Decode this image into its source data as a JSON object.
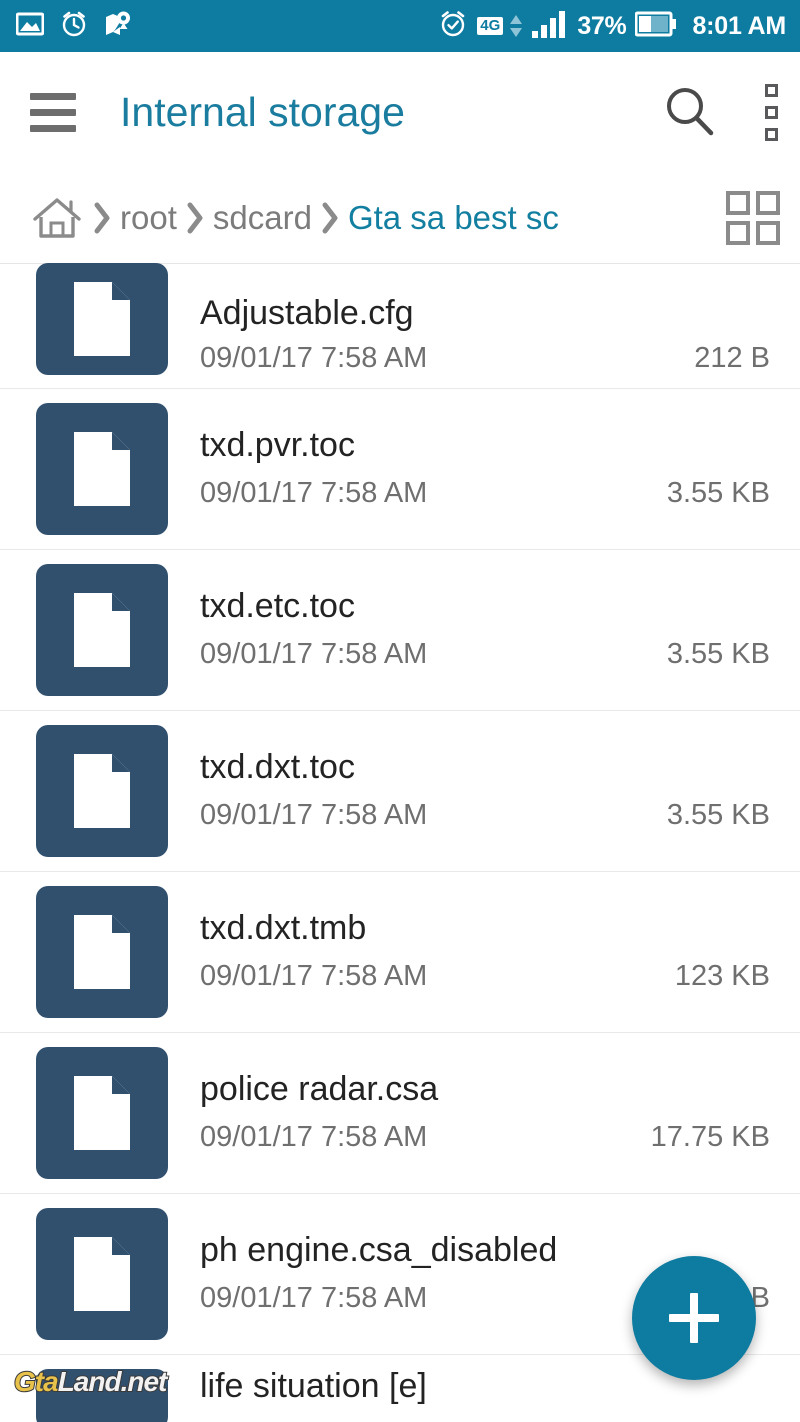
{
  "statusbar": {
    "background": "#0e7ca1",
    "left_icons": [
      "photo-icon",
      "alarm-clock-icon",
      "map-location-icon"
    ],
    "network_label": "4G",
    "battery_percent": "37%",
    "time": "8:01 AM",
    "right_icons": [
      "alarm-set-icon",
      "data-arrows-icon",
      "signal-bars-icon",
      "battery-icon"
    ]
  },
  "appbar": {
    "title": "Internal storage",
    "title_color": "#1a7c9e",
    "menu_icon": "hamburger-icon",
    "search_icon": "search-icon",
    "overflow_icon": "overflow-menu-icon"
  },
  "breadcrumb": {
    "home_icon": "home-icon",
    "separator": "›",
    "items": [
      {
        "label": "root",
        "active": false
      },
      {
        "label": "sdcard",
        "active": false
      },
      {
        "label": "Gta sa best sc",
        "active": true
      }
    ],
    "active_color": "#127fa1",
    "view_toggle_icon": "grid-view-icon"
  },
  "files": {
    "icon_color": "#31506e",
    "items": [
      {
        "name": "Adjustable.cfg",
        "date": "09/01/17 7:58 AM",
        "size": "212 B",
        "icon": "file-icon",
        "clipped": "top"
      },
      {
        "name": "txd.pvr.toc",
        "date": "09/01/17 7:58 AM",
        "size": "3.55 KB",
        "icon": "file-icon",
        "clipped": ""
      },
      {
        "name": "txd.etc.toc",
        "date": "09/01/17 7:58 AM",
        "size": "3.55 KB",
        "icon": "file-icon",
        "clipped": ""
      },
      {
        "name": "txd.dxt.toc",
        "date": "09/01/17 7:58 AM",
        "size": "3.55 KB",
        "icon": "file-icon",
        "clipped": ""
      },
      {
        "name": "txd.dxt.tmb",
        "date": "09/01/17 7:58 AM",
        "size": "123 KB",
        "icon": "file-icon",
        "clipped": ""
      },
      {
        "name": "police radar.csa",
        "date": "09/01/17 7:58 AM",
        "size": "17.75 KB",
        "icon": "file-icon",
        "clipped": ""
      },
      {
        "name": "ph engine.csa_disabled",
        "date": "09/01/17 7:58 AM",
        "size": "B",
        "icon": "file-icon",
        "clipped": ""
      },
      {
        "name": "life situation [e]",
        "date": "",
        "size": "",
        "icon": "file-icon",
        "clipped": "bottom"
      }
    ]
  },
  "fab": {
    "icon": "plus-icon",
    "color": "#0e7ca1"
  },
  "watermark": {
    "part1": "Gta",
    "part2": "Land.net"
  }
}
